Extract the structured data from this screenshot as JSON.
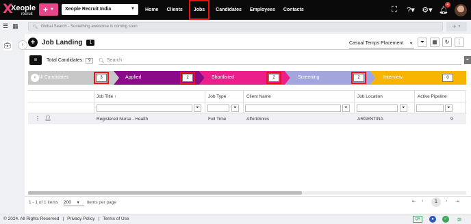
{
  "brand": {
    "logo_text": "Xeople",
    "logo_sub": "recruit"
  },
  "topbar": {
    "add_label": "+",
    "company": "Xeople Recruit India",
    "nav": [
      "Home",
      "Clients",
      "Jobs",
      "Candidates",
      "Employees",
      "Contacts"
    ],
    "active_nav": "Jobs",
    "notification_count": "4"
  },
  "search": {
    "placeholder": "Global Search - Something awesome is coming soon",
    "right_add": "+"
  },
  "page": {
    "title": "Job Landing",
    "count": "1",
    "placement_select": "Casual Temps Placement",
    "total_label": "Total Candidates:",
    "total_value": "9",
    "search_placeholder": "Search"
  },
  "pipeline": [
    {
      "label": "All Candidates",
      "count": "3",
      "color": "#c8c8c8",
      "text_color": "#ffffff",
      "highlight": true
    },
    {
      "label": "Applied",
      "count": "2",
      "color": "#8b0a8a",
      "text_color": "#ffffff",
      "highlight": true
    },
    {
      "label": "Shortlisted",
      "count": "2",
      "color": "#ec1e8c",
      "text_color": "#ffffff",
      "highlight": true
    },
    {
      "label": "Screening",
      "count": "2",
      "color": "#a3a6dc",
      "text_color": "#ffffff",
      "highlight": true
    },
    {
      "label": "Interview",
      "count": "0",
      "color": "#f7b500",
      "text_color": "#ffffff",
      "highlight": false
    }
  ],
  "grid": {
    "columns": [
      "Job Title",
      "Job Type",
      "Client Name",
      "Job Location",
      "Active Pipeline"
    ],
    "sort_indicator": "↑",
    "rows": [
      {
        "job_title": "Registered Nurse - Health",
        "job_type": "Full Time",
        "client": "Affortclinics",
        "location": "ARGENTINA",
        "pipeline": "9"
      }
    ]
  },
  "pager": {
    "info": "1 - 1 of 1 items",
    "page_size": "200",
    "page_size_label": "items per page",
    "current_page": "1"
  },
  "footer": {
    "copyright": "© 2024. All Rights Reserved",
    "sep": "|",
    "privacy": "Privacy Policy",
    "terms": "Terms of Use",
    "qa": "QA"
  },
  "colors": {
    "brand_pink": "#e8458a",
    "active_outline": "#e11111",
    "topbar_bg": "#0a0a0a"
  }
}
